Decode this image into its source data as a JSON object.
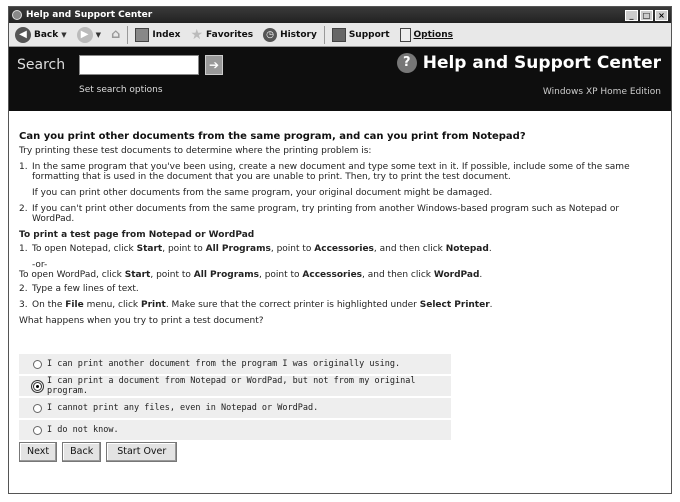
{
  "window": {
    "title": "Help and Support Center"
  },
  "toolbar": {
    "back": "Back",
    "index": "Index",
    "favorites": "Favorites",
    "history": "History",
    "support": "Support",
    "options": "Options"
  },
  "search": {
    "label": "Search",
    "value": "",
    "set_options": "Set search options",
    "brand_title": "Help and Support Center",
    "edition": "Windows XP Home Edition"
  },
  "content": {
    "question": "Can you print other documents from the same program, and can you print from Notepad?",
    "intro": "Try printing these test documents to determine where the printing problem is:",
    "steps": [
      {
        "num": "1.",
        "text": "In the same program that you've been using, create a new document and type some text in it. If possible, include some of the same formatting that is used in the document that you are unable to print. Then, try to print the test document."
      },
      {
        "num": "2.",
        "text": "If you can't print other documents from the same program, try printing from another Windows-based program such as Notepad or WordPad."
      }
    ],
    "step1_note": "If you can print other documents from the same program, your original document might be damaged.",
    "test_heading": "To print a test page from Notepad or WordPad",
    "test_steps": {
      "s1_num": "1.",
      "s1_a": "To open Notepad, click ",
      "s1_start": "Start",
      "s1_b": ", point to ",
      "s1_allprog": "All Programs",
      "s1_c": ", point to ",
      "s1_acc": "Accessories",
      "s1_d": ", and then click ",
      "s1_notepad": "Notepad",
      "s1_e": ".",
      "or": "-or-",
      "w_a": "To open WordPad, click ",
      "w_start": "Start",
      "w_b": ", point to ",
      "w_allprog": "All Programs",
      "w_c": ", point to ",
      "w_acc": "Accessories",
      "w_d": ", and then click ",
      "w_wordpad": "WordPad",
      "w_e": ".",
      "s2_num": "2.",
      "s2": "Type a few lines of text.",
      "s3_num": "3.",
      "s3_a": "On the ",
      "s3_file": "File",
      "s3_b": " menu, click ",
      "s3_print": "Print",
      "s3_c": ". Make sure that the correct printer is highlighted under ",
      "s3_select": "Select Printer",
      "s3_d": "."
    },
    "prompt": "What happens when you try to print a test document?"
  },
  "answers": [
    {
      "label": "I can print another document from the program I was originally using.",
      "checked": false
    },
    {
      "label": "I can print a document from Notepad or WordPad, but not from my original program.",
      "checked": true
    },
    {
      "label": "I cannot print any files, even in Notepad or WordPad.",
      "checked": false
    },
    {
      "label": "I do not know.",
      "checked": false
    }
  ],
  "buttons": {
    "next": "Next",
    "back": "Back",
    "start_over": "Start Over"
  }
}
